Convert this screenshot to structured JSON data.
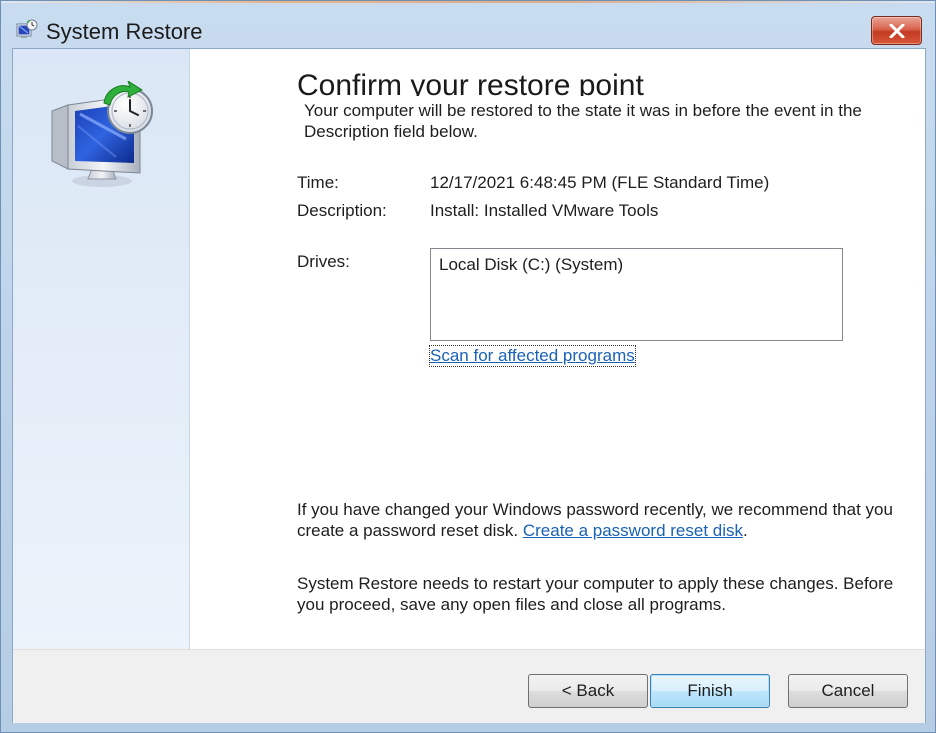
{
  "window": {
    "title": "System Restore",
    "icons": {
      "title": "system-restore-icon",
      "close": "close-icon",
      "side": "monitor-clock-icon"
    },
    "colors": {
      "close_button": "#c33a22",
      "link": "#1a62b4",
      "default_button_border": "#3c7fb1"
    }
  },
  "main": {
    "heading": "Confirm your restore point",
    "intro": "Your computer will be restored to the state it was in before the event in the Description field below.",
    "time_label": "Time:",
    "time_value": "12/17/2021 6:48:45 PM (FLE Standard Time)",
    "description_label": "Description:",
    "description_value": "Install: Installed VMware Tools",
    "drives_label": "Drives:",
    "drives": [
      "Local Disk (C:) (System)"
    ],
    "scan_link": "Scan for affected programs",
    "password_note_prefix": "If you have changed your Windows password recently, we recommend that you create a password reset disk.",
    "password_link": "Create a password reset disk",
    "password_note_suffix": ".",
    "restart_note": "System Restore needs to restart your computer to apply these changes. Before you proceed, save any open files and close all programs."
  },
  "footer": {
    "back_label": "< Back",
    "finish_label": "Finish",
    "cancel_label": "Cancel"
  }
}
